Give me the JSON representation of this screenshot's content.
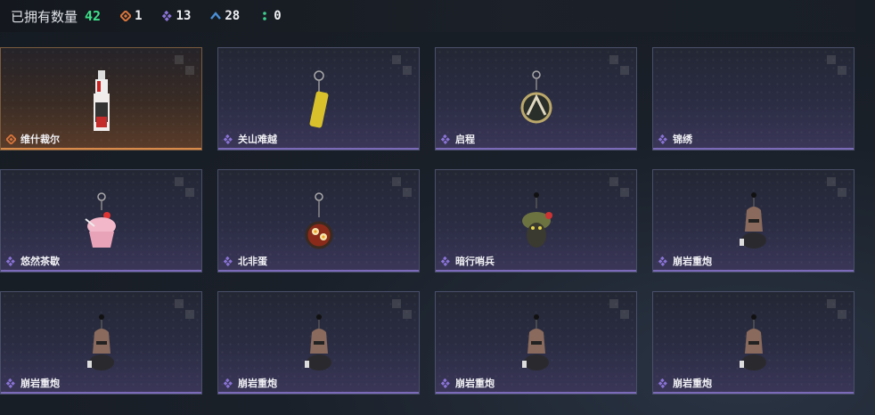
{
  "header": {
    "owned_label": "已拥有数量",
    "owned_count": "42",
    "stats": [
      {
        "icon": "orange-diamond-icon",
        "value": "1",
        "color": "#d9743a"
      },
      {
        "icon": "purple-diamond-icon",
        "value": "13",
        "color": "#8a73d6"
      },
      {
        "icon": "blue-chevron-icon",
        "value": "28",
        "color": "#4a8fd6"
      },
      {
        "icon": "green-dots-icon",
        "value": "0",
        "color": "#3ecf8e"
      }
    ]
  },
  "items": [
    {
      "name": "维什裁尔",
      "rarity": "orange",
      "art": "bottle"
    },
    {
      "name": "关山难越",
      "rarity": "purple",
      "art": "bar"
    },
    {
      "name": "启程",
      "rarity": "purple",
      "art": "medal"
    },
    {
      "name": "锦绣",
      "rarity": "purple",
      "art": "none"
    },
    {
      "name": "悠然茶歇",
      "rarity": "purple",
      "art": "cupcake"
    },
    {
      "name": "北非蛋",
      "rarity": "purple",
      "art": "pan"
    },
    {
      "name": "暗行哨兵",
      "rarity": "purple",
      "art": "creature"
    },
    {
      "name": "崩岩重炮",
      "rarity": "purple",
      "art": "figure"
    },
    {
      "name": "崩岩重炮",
      "rarity": "purple",
      "art": "figure"
    },
    {
      "name": "崩岩重炮",
      "rarity": "purple",
      "art": "figure"
    },
    {
      "name": "崩岩重炮",
      "rarity": "purple",
      "art": "figure"
    },
    {
      "name": "崩岩重炮",
      "rarity": "purple",
      "art": "figure"
    }
  ]
}
